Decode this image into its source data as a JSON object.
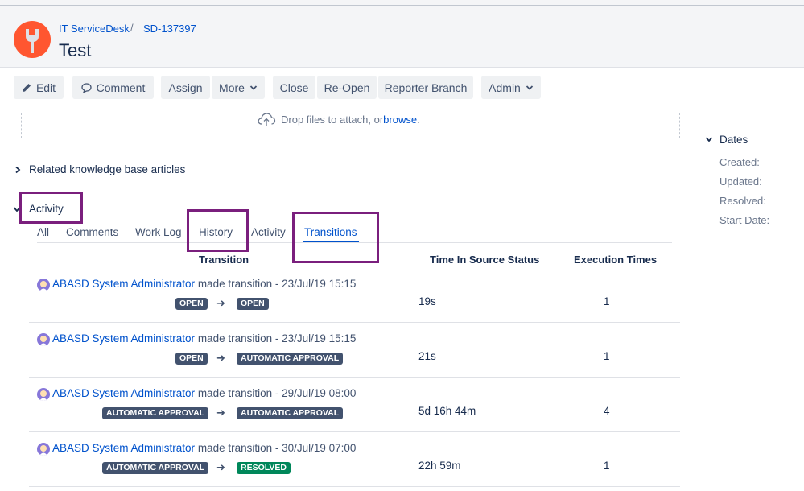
{
  "breadcrumb": {
    "project": "IT ServiceDesk",
    "separator": "/",
    "issue_key": "SD-137397"
  },
  "issue": {
    "title": "Test"
  },
  "toolbar": {
    "edit": "Edit",
    "comment": "Comment",
    "assign": "Assign",
    "more": "More",
    "close": "Close",
    "reopen": "Re-Open",
    "reporter_branch": "Reporter Branch",
    "admin": "Admin"
  },
  "attachments": {
    "drop_text": "Drop files to attach, or ",
    "browse": "browse",
    "period": "."
  },
  "sections": {
    "related_kb": "Related knowledge base articles",
    "activity": "Activity"
  },
  "dates": {
    "header": "Dates",
    "created": "Created:",
    "updated": "Updated:",
    "resolved": "Resolved:",
    "start_date": "Start Date:"
  },
  "tabs": [
    "All",
    "Comments",
    "Work Log",
    "History",
    "Activity",
    "Transitions"
  ],
  "active_tab": "Transitions",
  "columns": {
    "transition": "Transition",
    "time_in_source": "Time In Source Status",
    "execution_times": "Execution Times"
  },
  "transitions": [
    {
      "user": "ABASD System Administrator",
      "action": " made transition - ",
      "date": "23/Jul/19 15:15",
      "from": "OPEN",
      "to": "OPEN",
      "to_color": "#42526e",
      "time": "19s",
      "count": "1"
    },
    {
      "user": "ABASD System Administrator",
      "action": " made transition - ",
      "date": "23/Jul/19 15:15",
      "from": "OPEN",
      "to": "AUTOMATIC APPROVAL",
      "to_color": "#42526e",
      "time": "21s",
      "count": "1"
    },
    {
      "user": "ABASD System Administrator",
      "action": " made transition - ",
      "date": "29/Jul/19 08:00",
      "from": "AUTOMATIC APPROVAL",
      "to": "AUTOMATIC APPROVAL",
      "to_color": "#42526e",
      "time": "5d 16h 44m",
      "count": "4"
    },
    {
      "user": "ABASD System Administrator",
      "action": " made transition - ",
      "date": "30/Jul/19 07:00",
      "from": "AUTOMATIC APPROVAL",
      "to": "RESOLVED",
      "to_color": "#00875a",
      "time": "22h 59m",
      "count": "1"
    }
  ],
  "colors": {
    "link": "#0052cc",
    "highlight": "#7a1f7d",
    "lozenge_default": "#42526e",
    "lozenge_done": "#00875a"
  }
}
